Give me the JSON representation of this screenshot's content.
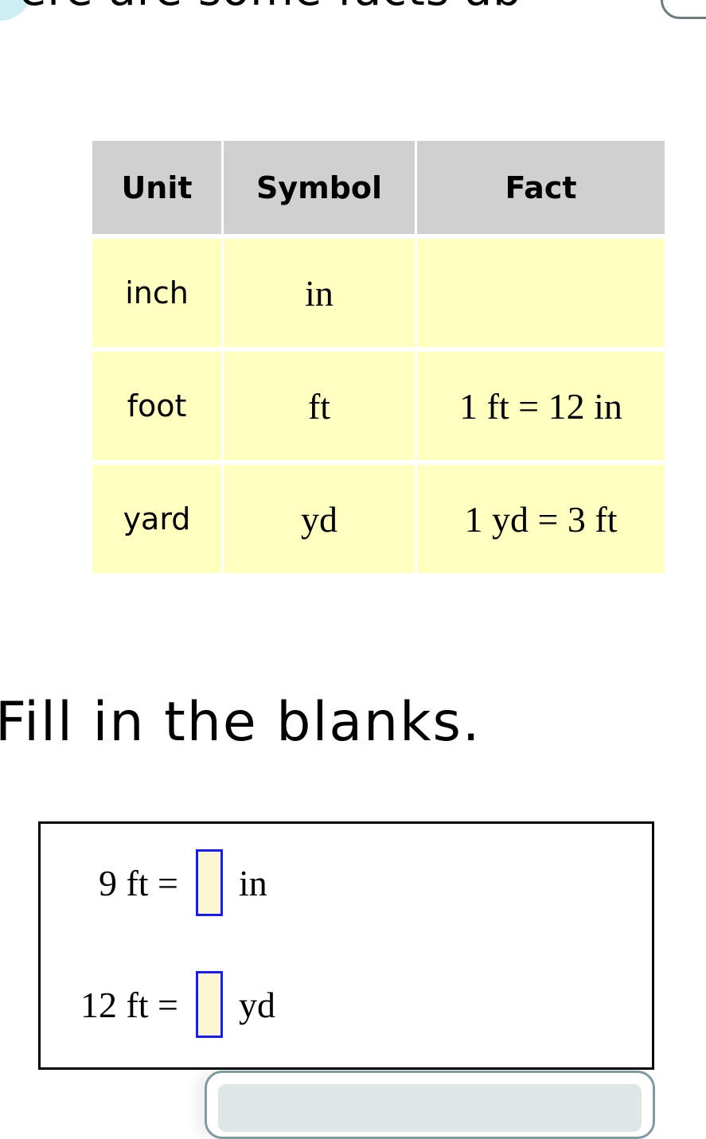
{
  "intro": {
    "heading_partial": "ere are some facts ab"
  },
  "facts_table": {
    "headers": [
      "Unit",
      "Symbol",
      "Fact"
    ],
    "rows": [
      {
        "unit": "inch",
        "symbol": "in",
        "fact": ""
      },
      {
        "unit": "foot",
        "symbol": "ft",
        "fact": "1 ft = 12 in"
      },
      {
        "unit": "yard",
        "symbol": "yd",
        "fact": "1 yd = 3 ft"
      }
    ]
  },
  "instructions": "Fill in the blanks.",
  "problems": [
    {
      "lhs": "9 ft =",
      "answer_value": "",
      "unit": "in"
    },
    {
      "lhs": "12 ft =",
      "answer_value": "",
      "unit": "yd"
    }
  ],
  "colors": {
    "header_bg": "#d0d0d0",
    "cell_bg": "#ffffc0",
    "answer_border": "#1a1aff",
    "answer_bg": "#fdf6d3",
    "accent_blob": "#cdeef3"
  }
}
